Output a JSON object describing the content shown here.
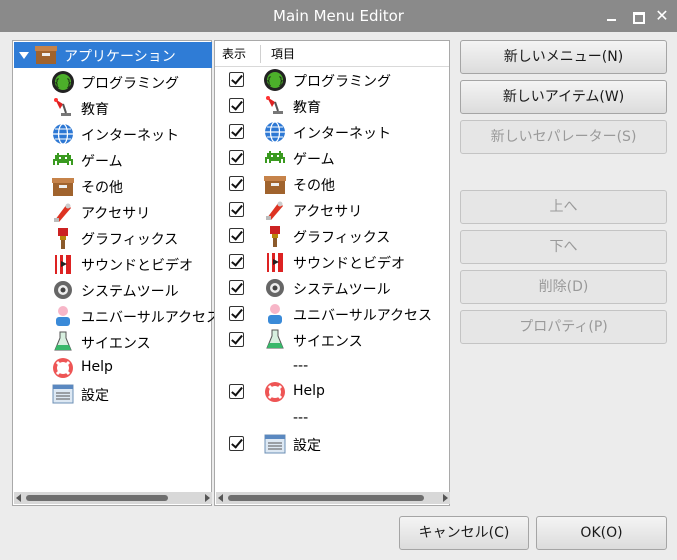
{
  "window": {
    "title": "Main Menu Editor",
    "controls": [
      "minimize-icon",
      "maximize-icon",
      "close-icon"
    ]
  },
  "tree": {
    "root": {
      "label": "アプリケーション",
      "icon": "applications-folder-icon"
    },
    "items": [
      {
        "label": "プログラミング",
        "icon": "programming-icon"
      },
      {
        "label": "教育",
        "icon": "education-icon"
      },
      {
        "label": "インターネット",
        "icon": "internet-icon"
      },
      {
        "label": "ゲーム",
        "icon": "games-icon"
      },
      {
        "label": "その他",
        "icon": "accessories-icon"
      },
      {
        "label": "アクセサリ",
        "icon": "tools-icon"
      },
      {
        "label": "グラフィックス",
        "icon": "graphics-icon"
      },
      {
        "label": "サウンドとビデオ",
        "icon": "sound-video-icon"
      },
      {
        "label": "システムツール",
        "icon": "system-tools-icon"
      },
      {
        "label": "ユニバーサルアクセス",
        "icon": "universal-access-icon"
      },
      {
        "label": "サイエンス",
        "icon": "science-icon"
      },
      {
        "label": "Help",
        "icon": "help-icon"
      },
      {
        "label": "設定",
        "icon": "preferences-icon"
      }
    ]
  },
  "list": {
    "headers": {
      "show": "表示",
      "item": "項目"
    },
    "rows": [
      {
        "type": "item",
        "checked": true,
        "label": "プログラミング",
        "icon": "programming-icon"
      },
      {
        "type": "item",
        "checked": true,
        "label": "教育",
        "icon": "education-icon"
      },
      {
        "type": "item",
        "checked": true,
        "label": "インターネット",
        "icon": "internet-icon"
      },
      {
        "type": "item",
        "checked": true,
        "label": "ゲーム",
        "icon": "games-icon"
      },
      {
        "type": "item",
        "checked": true,
        "label": "その他",
        "icon": "accessories-icon"
      },
      {
        "type": "item",
        "checked": true,
        "label": "アクセサリ",
        "icon": "tools-icon"
      },
      {
        "type": "item",
        "checked": true,
        "label": "グラフィックス",
        "icon": "graphics-icon"
      },
      {
        "type": "item",
        "checked": true,
        "label": "サウンドとビデオ",
        "icon": "sound-video-icon"
      },
      {
        "type": "item",
        "checked": true,
        "label": "システムツール",
        "icon": "system-tools-icon"
      },
      {
        "type": "item",
        "checked": true,
        "label": "ユニバーサルアクセス",
        "icon": "universal-access-icon"
      },
      {
        "type": "item",
        "checked": true,
        "label": "サイエンス",
        "icon": "science-icon"
      },
      {
        "type": "separator",
        "label": "---"
      },
      {
        "type": "item",
        "checked": true,
        "label": "Help",
        "icon": "help-icon"
      },
      {
        "type": "separator",
        "label": "---"
      },
      {
        "type": "item",
        "checked": true,
        "label": "設定",
        "icon": "preferences-icon"
      }
    ]
  },
  "buttons": {
    "new_menu": "新しいメニュー(N)",
    "new_item": "新しいアイテム(W)",
    "new_separator": "新しいセパレーター(S)",
    "move_up": "上へ",
    "move_down": "下へ",
    "delete": "削除(D)",
    "properties": "プロパティ(P)",
    "cancel": "キャンセル(C)",
    "ok": "OK(O)"
  },
  "colors": {
    "titlebar": "#8a8a8a",
    "selection": "#2f7cd6"
  }
}
